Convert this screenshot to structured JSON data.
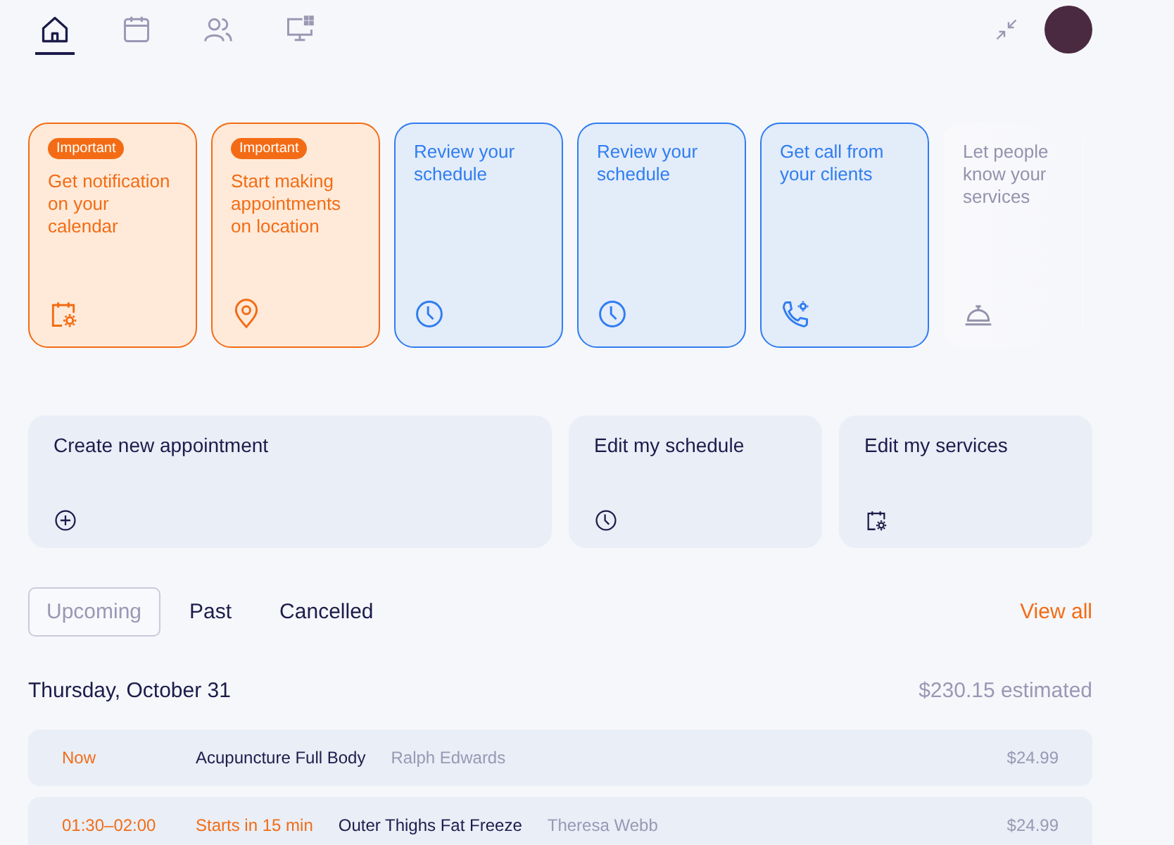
{
  "nav": {
    "tabs": [
      {
        "selected": true
      },
      {
        "selected": false
      },
      {
        "selected": false
      },
      {
        "selected": false
      }
    ]
  },
  "cards": [
    {
      "kind": "important",
      "badge": "Important",
      "text": "Get notification on your calendar"
    },
    {
      "kind": "important",
      "badge": "Important",
      "text": "Start making appointments on location"
    },
    {
      "kind": "info",
      "text": "Review your schedule"
    },
    {
      "kind": "info",
      "text": "Review your schedule"
    },
    {
      "kind": "info",
      "text": "Get call from your clients"
    },
    {
      "kind": "faded",
      "text": "Let people know your services"
    }
  ],
  "actions": [
    {
      "label": "Create new appointment"
    },
    {
      "label": "Edit my schedule"
    },
    {
      "label": "Edit my services"
    }
  ],
  "filters": [
    {
      "label": "Upcoming",
      "selected": true
    },
    {
      "label": "Past",
      "selected": false
    },
    {
      "label": "Cancelled",
      "selected": false
    }
  ],
  "view_all": "View all",
  "day": {
    "date": "Thursday, October 31",
    "estimate": "$230.15 estimated"
  },
  "appointments": [
    {
      "time": "Now",
      "service": "Acupuncture Full Body",
      "client": "Ralph Edwards",
      "price": "$24.99"
    },
    {
      "time": "01:30–02:00",
      "status": "Starts in 15 min",
      "service": "Outer Thighs Fat Freeze",
      "client": "Theresa Webb",
      "price": "$24.99"
    }
  ]
}
